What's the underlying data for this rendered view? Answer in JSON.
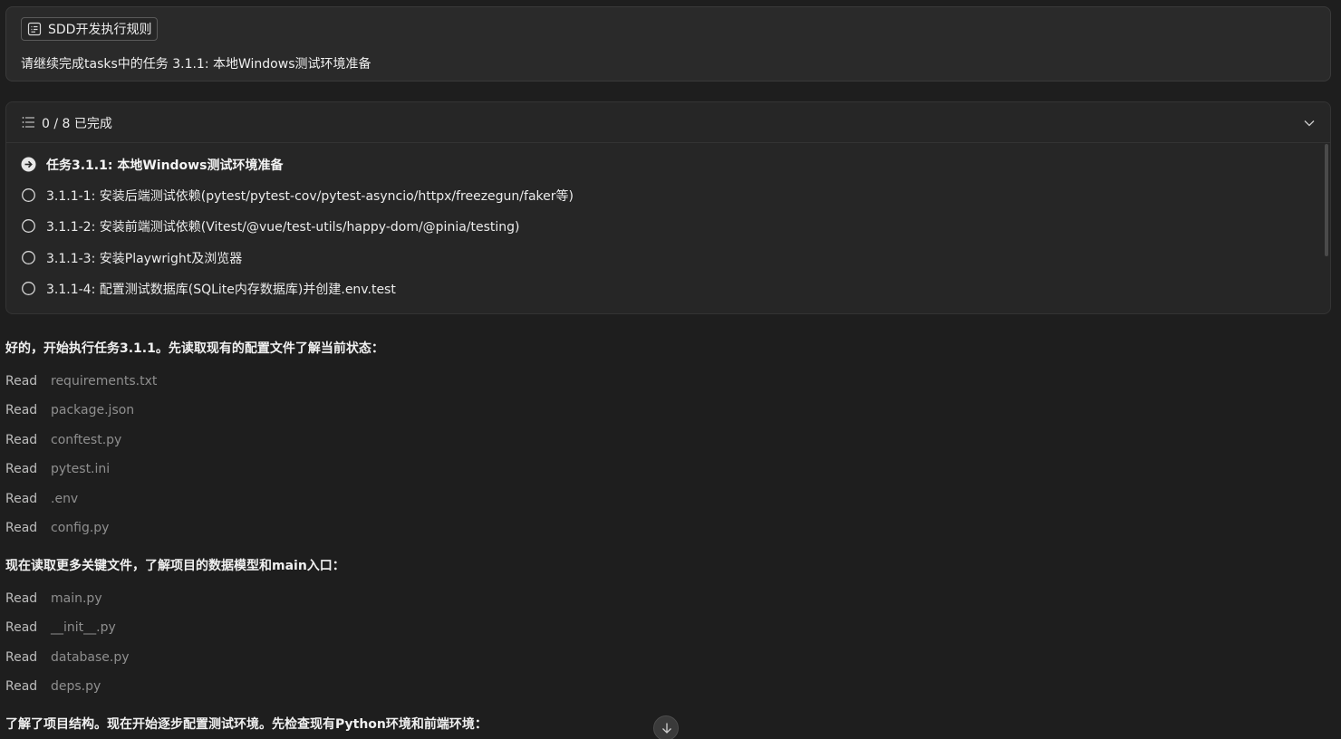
{
  "prompt": {
    "rule_chip": "SDD开发执行规则",
    "text": "请继续完成tasks中的任务 3.1.1: 本地Windows测试环境准备"
  },
  "todos": {
    "progress": "0 / 8 已完成",
    "items": [
      {
        "label": "任务3.1.1: 本地Windows测试环境准备",
        "status": "in-progress"
      },
      {
        "label": "3.1.1-1: 安装后端测试依赖(pytest/pytest-cov/pytest-asyncio/httpx/freezegun/faker等)",
        "status": "pending"
      },
      {
        "label": "3.1.1-2: 安装前端测试依赖(Vitest/@vue/test-utils/happy-dom/@pinia/testing)",
        "status": "pending"
      },
      {
        "label": "3.1.1-3: 安装Playwright及浏览器",
        "status": "pending"
      },
      {
        "label": "3.1.1-4: 配置测试数据库(SQLite内存数据库)并创建.env.test",
        "status": "pending"
      }
    ]
  },
  "transcript": {
    "msg1": "好的，开始执行任务3.1.1。先读取现有的配置文件了解当前状态：",
    "reads1": [
      {
        "verb": "Read",
        "file": "requirements.txt"
      },
      {
        "verb": "Read",
        "file": "package.json"
      },
      {
        "verb": "Read",
        "file": "conftest.py"
      },
      {
        "verb": "Read",
        "file": "pytest.ini"
      },
      {
        "verb": "Read",
        "file": ".env"
      },
      {
        "verb": "Read",
        "file": "config.py"
      }
    ],
    "msg2": "现在读取更多关键文件，了解项目的数据模型和main入口：",
    "reads2": [
      {
        "verb": "Read",
        "file": "main.py"
      },
      {
        "verb": "Read",
        "file": "__init__.py"
      },
      {
        "verb": "Read",
        "file": "database.py"
      },
      {
        "verb": "Read",
        "file": "deps.py"
      }
    ],
    "msg3": "了解了项目结构。现在开始逐步配置测试环境。先检查现有Python环境和前端环境："
  },
  "icons": {
    "rule": "rule-document-icon",
    "list": "checklist-icon",
    "collapse": "chevron-down-icon",
    "in_progress": "arrow-circle-icon",
    "pending": "empty-circle-icon",
    "scroll": "arrow-down-icon"
  }
}
